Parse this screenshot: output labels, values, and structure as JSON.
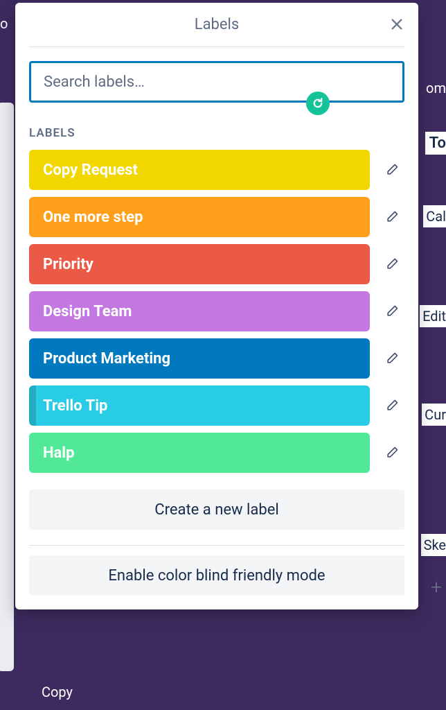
{
  "popover": {
    "title": "Labels",
    "search_placeholder": "Search labels…",
    "section_heading": "LABELS",
    "create_label": "Create a new label",
    "colorblind_mode": "Enable color blind friendly mode"
  },
  "labels": [
    {
      "name": "Copy Request",
      "color": "#f2d600",
      "accent": false
    },
    {
      "name": "One more step",
      "color": "#ff9f1a",
      "accent": false
    },
    {
      "name": "Priority",
      "color": "#eb5a46",
      "accent": false
    },
    {
      "name": "Design Team",
      "color": "#c377e0",
      "accent": false
    },
    {
      "name": "Product Marketing",
      "color": "#0079bf",
      "accent": false
    },
    {
      "name": "Trello Tip",
      "color": "#29cce5",
      "accent": true
    },
    {
      "name": "Halp",
      "color": "#51e898",
      "accent": false
    }
  ],
  "background": {
    "top_left": "o",
    "to": "To",
    "com": "om",
    "cal": "Cal",
    "edit": "Edit",
    "cur": "Cur",
    "ske": "Ske",
    "copy_btn": "Copy"
  }
}
